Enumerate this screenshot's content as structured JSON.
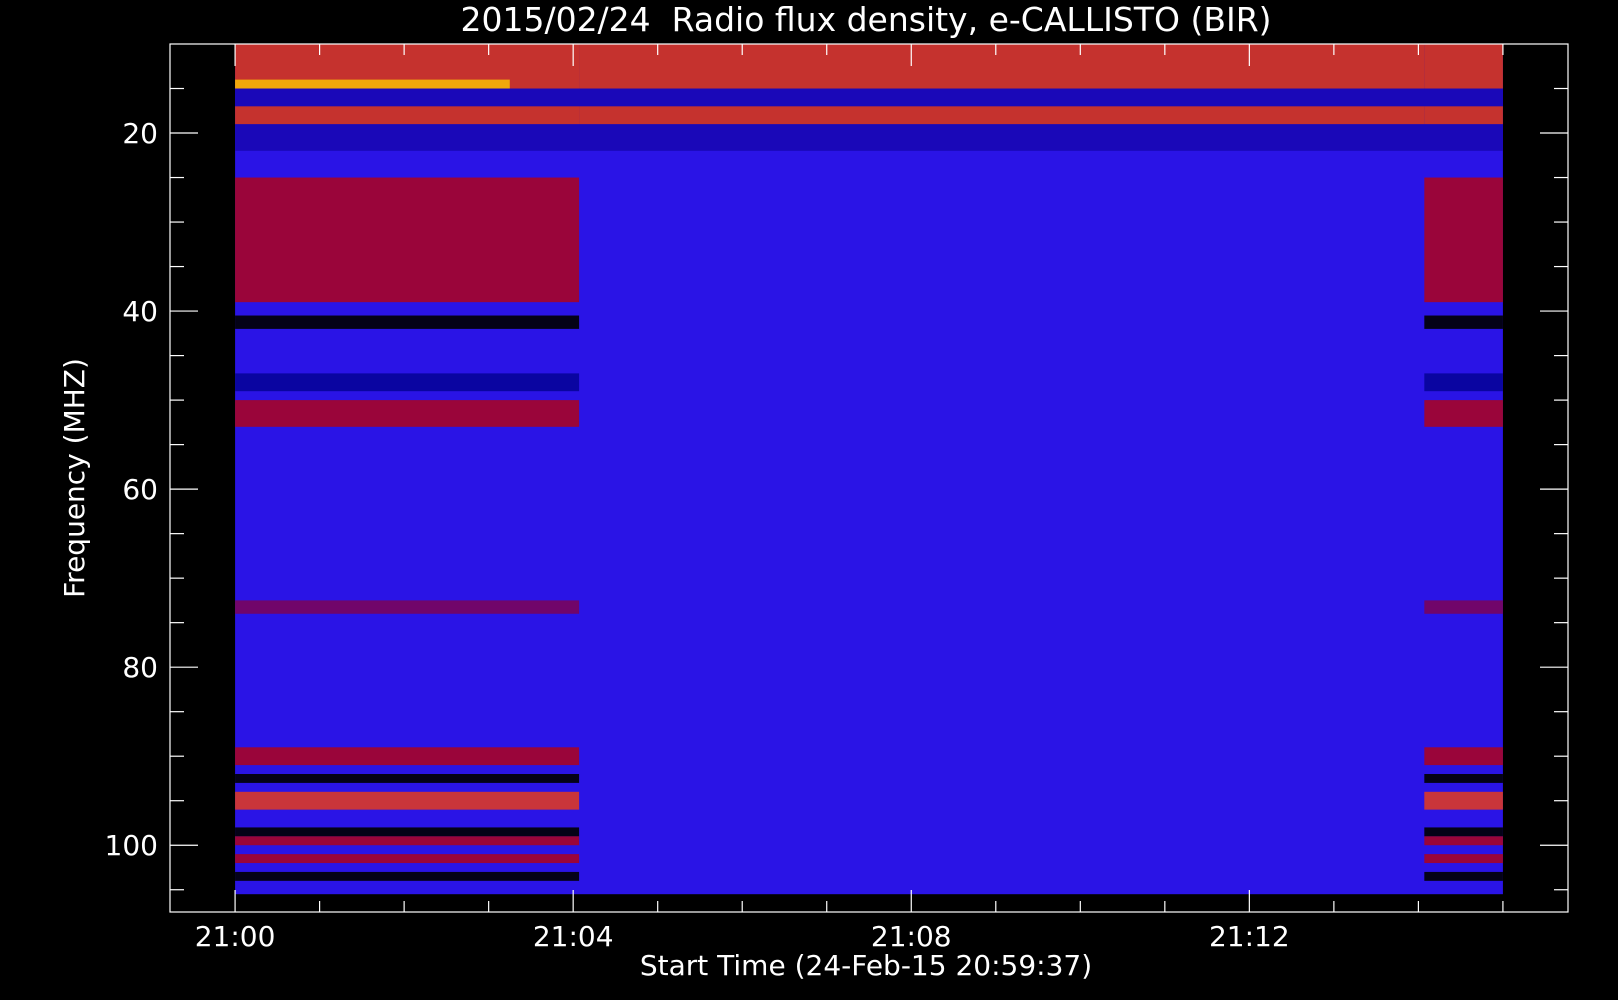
{
  "chart_data": {
    "type": "heatmap",
    "title": "2015/02/24  Radio flux density, e-CALLISTO (BIR)",
    "xlabel": "Start Time (24-Feb-15 20:59:37)",
    "ylabel": "Frequency (MHZ)",
    "x_ticks": [
      "21:00",
      "21:04",
      "21:08",
      "21:12"
    ],
    "x_tick_values_min": [
      0,
      4,
      8,
      12
    ],
    "x_range_min": [
      -0.77,
      15.77
    ],
    "x_data_range_min": [
      0,
      15
    ],
    "y_ticks": [
      "20",
      "40",
      "60",
      "80",
      "100"
    ],
    "y_tick_values": [
      20,
      40,
      60,
      80,
      100
    ],
    "ylim": [
      10,
      107.5
    ],
    "y_data_range": [
      10,
      105.5
    ],
    "y_inverted": true,
    "colormap": [
      "#000000",
      "#0000ff",
      "#c00000",
      "#ff4000",
      "#ffd000",
      "#ffffff"
    ],
    "segments": [
      {
        "start_min": 0.0,
        "end_min": 4.07,
        "activity": "high"
      },
      {
        "start_min": 4.07,
        "end_min": 14.07,
        "activity": "low"
      },
      {
        "start_min": 14.07,
        "end_min": 15.0,
        "activity": "high"
      }
    ],
    "bands_mhz": [
      {
        "from": 10,
        "to": 15,
        "color": "#ff4000",
        "segments": "all"
      },
      {
        "from": 14,
        "to": 15,
        "color": "#ffd000",
        "segments": "first_partial"
      },
      {
        "from": 17,
        "to": 19,
        "color": "#ff4000",
        "segments": "all"
      },
      {
        "from": 25,
        "to": 39,
        "color": "#c00000",
        "segments": "high"
      },
      {
        "from": 40.5,
        "to": 42,
        "color": "#000000",
        "segments": "high"
      },
      {
        "from": 47,
        "to": 49,
        "color": "#00008a",
        "segments": "high"
      },
      {
        "from": 50,
        "to": 53,
        "color": "#c00000",
        "segments": "high"
      },
      {
        "from": 72.5,
        "to": 74,
        "color": "#8a0040",
        "segments": "high"
      },
      {
        "from": 89,
        "to": 91,
        "color": "#c00000",
        "segments": "high"
      },
      {
        "from": 92,
        "to": 93,
        "color": "#000000",
        "segments": "high"
      },
      {
        "from": 94,
        "to": 96,
        "color": "#ff4000",
        "segments": "high"
      },
      {
        "from": 98,
        "to": 99,
        "color": "#000000",
        "segments": "high"
      },
      {
        "from": 99,
        "to": 100,
        "color": "#c00000",
        "segments": "high"
      },
      {
        "from": 101,
        "to": 102,
        "color": "#c00000",
        "segments": "high"
      },
      {
        "from": 103,
        "to": 104,
        "color": "#000000",
        "segments": "high"
      }
    ]
  }
}
